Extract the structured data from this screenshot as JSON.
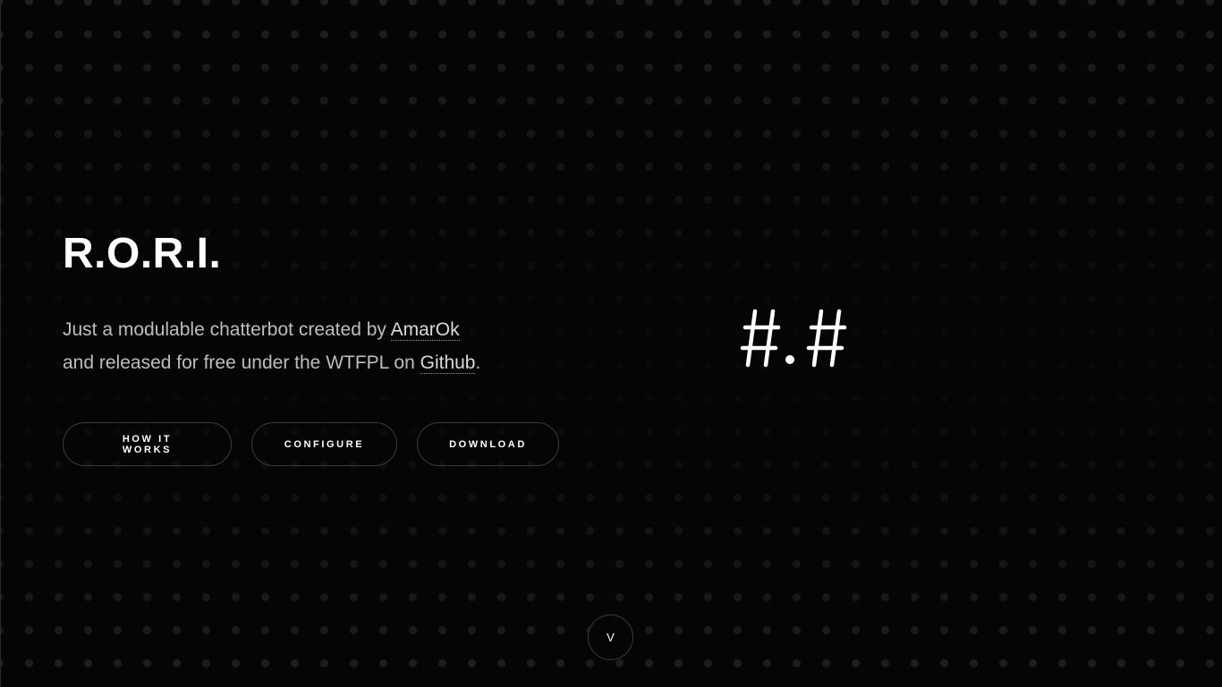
{
  "hero": {
    "title": "R.O.R.I.",
    "tagline": {
      "line1_prefix": "Just a modulable chatterbot created by ",
      "author_link": "AmarOk",
      "line2_prefix": "and released for free under the WTFPL on ",
      "github_link": "Github",
      "line2_suffix": "."
    }
  },
  "buttons": {
    "how_it_works": "HOW IT WORKS",
    "configure": "CONFIGURE",
    "download": "DOWNLOAD"
  },
  "logo": {
    "icon": "hash-dot-hash-logo"
  },
  "scroll": {
    "label": "V"
  },
  "colors": {
    "background": "#050505",
    "text": "#ffffff",
    "muted_text": "#bdbdbd",
    "button_border": "#3a3a3a",
    "dot_pattern": "#1f1f1f"
  }
}
